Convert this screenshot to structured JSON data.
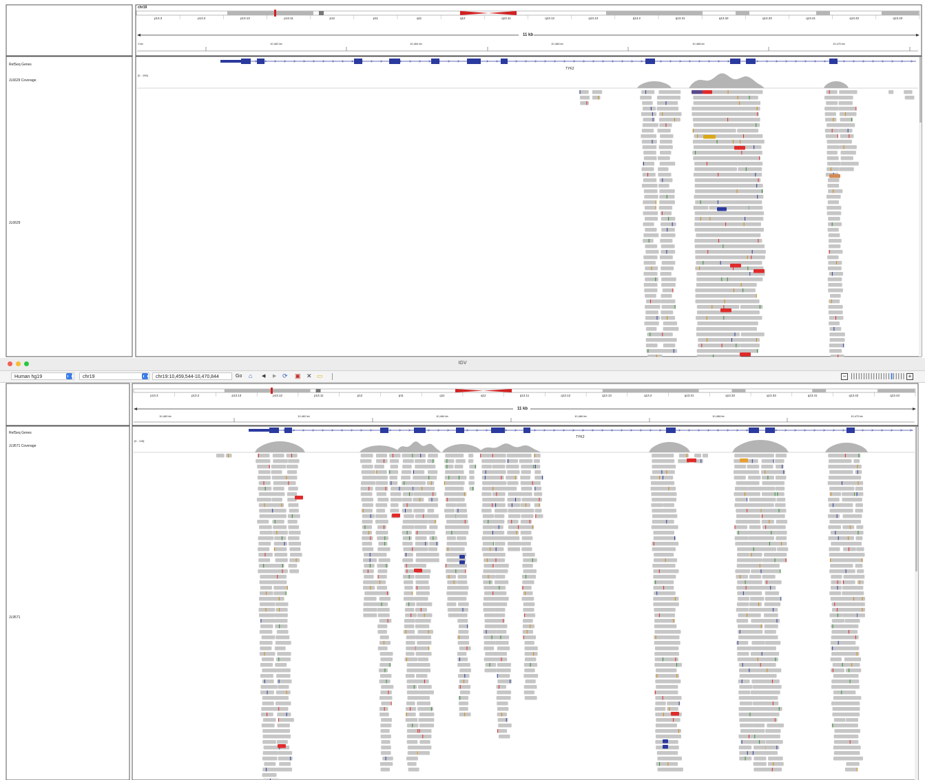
{
  "top_panel": {
    "chromosome": "chr19",
    "span_label": "11 kb",
    "ruler_ticks": [
      "0 kb",
      "10,462 kb",
      "10,464 kb",
      "10,466 kb",
      "10,468 kb",
      "10,470 kb"
    ],
    "tracks": {
      "refseq": "RefSeq Genes",
      "coverage": "JL6629 Coverage",
      "coverage_range": "[0 - 106]",
      "alignment": "JL6629"
    },
    "gene_name": "TYK2"
  },
  "bottom_panel": {
    "window_title": "IGV",
    "genome_select": "Human hg19",
    "chromosome_select": "chr19",
    "locus_input": "chr19:10,459,544-10,470,844",
    "go_label": "Go",
    "span_label": "11 kb",
    "ruler_ticks": [
      "10,460 kb",
      "10,462 kb",
      "10,464 kb",
      "10,466 kb",
      "10,468 kb",
      "10,470 kb"
    ],
    "tracks": {
      "refseq": "RefSeq Genes",
      "coverage": "JL9571 Coverage",
      "coverage_range": "[0 - 115]",
      "alignment": "JL9571"
    },
    "gene_name": "TYK2"
  },
  "ideogram_bands": [
    "p13.3",
    "p13.2",
    "p13.13",
    "p13.12",
    "p13.11",
    "p12",
    "p11",
    "q11",
    "q12",
    "q13.11",
    "q13.12",
    "q13.13",
    "q13.2",
    "q13.31",
    "q13.32",
    "q13.33",
    "q13.41",
    "q13.42",
    "q13.43"
  ],
  "top_ideogram_bands": [
    "p13.3",
    "p13.2",
    "p13.13",
    "p13.11",
    "p12",
    "p11",
    "q11",
    "q12",
    "q13.11",
    "q13.12",
    "q13.13",
    "q13.2",
    "q13.31",
    "q13.32",
    "q13.33",
    "q13.41",
    "q13.42",
    "q13.43"
  ],
  "colors": {
    "exon": "#2b3a9e",
    "coverage": "#b4b4b4",
    "read": "#c6c6c6",
    "mismatch_red": "#e02b2b",
    "accent_blue": "#3b7de8",
    "centromere": "#d32020"
  },
  "toolbar_icons": [
    "home-icon",
    "back-icon",
    "forward-icon",
    "refresh-icon",
    "ruler-icon",
    "close-icon",
    "comment-icon"
  ]
}
